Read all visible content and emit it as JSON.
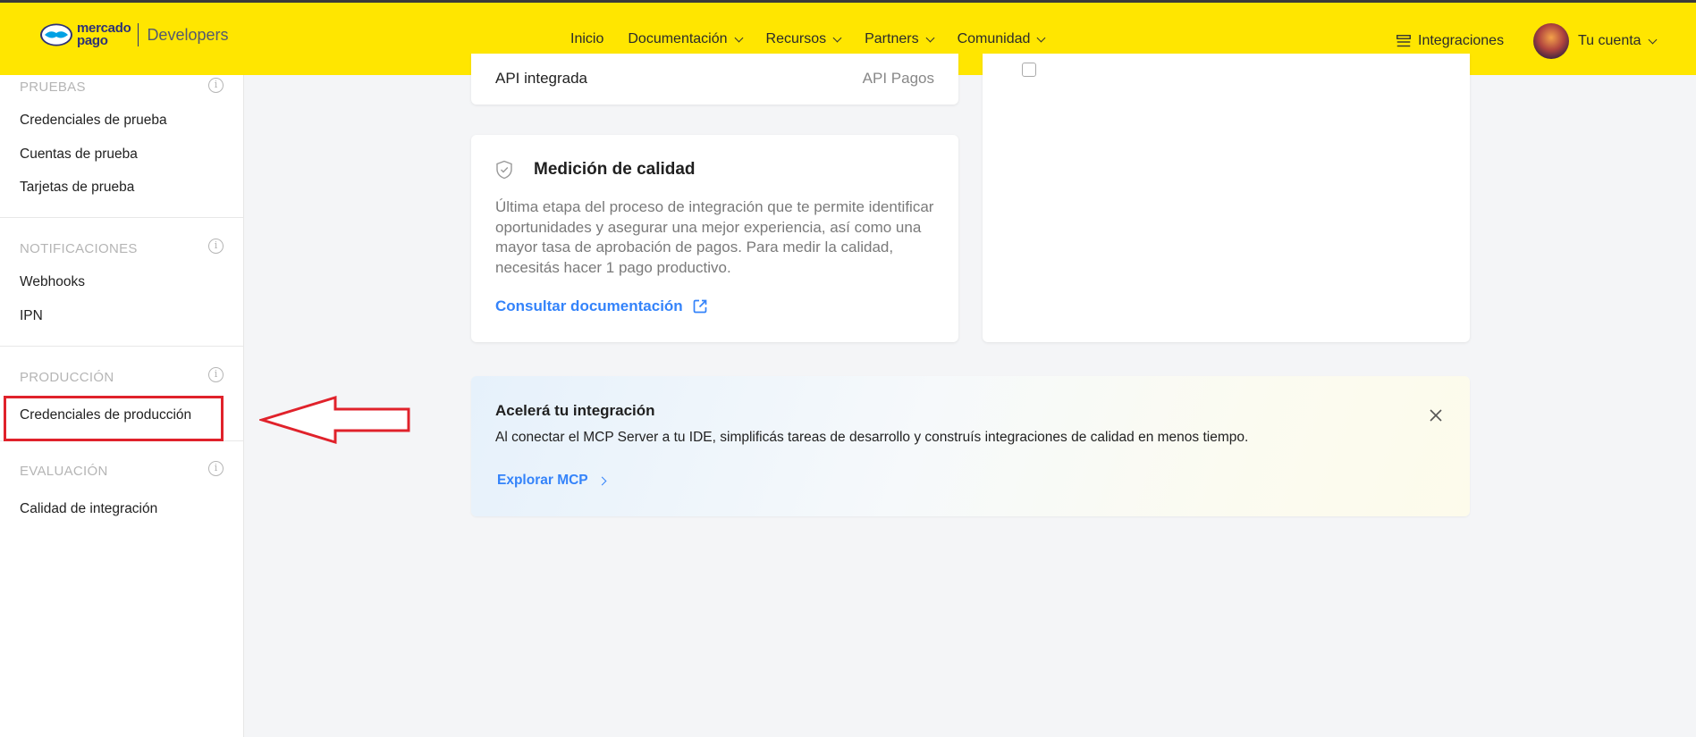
{
  "header": {
    "logo_line1": "mercado",
    "logo_line2": "pago",
    "logo_suffix": "Developers",
    "nav": [
      {
        "label": "Inicio",
        "dropdown": false
      },
      {
        "label": "Documentación",
        "dropdown": true
      },
      {
        "label": "Recursos",
        "dropdown": true
      },
      {
        "label": "Partners",
        "dropdown": true
      },
      {
        "label": "Comunidad",
        "dropdown": true
      }
    ],
    "integrations_label": "Integraciones",
    "account_label": "Tu cuenta",
    "brand_color": "#ffe600"
  },
  "sidebar": {
    "sections": [
      {
        "title": "PRUEBAS",
        "items": [
          "Credenciales de prueba",
          "Cuentas de prueba",
          "Tarjetas de prueba"
        ]
      },
      {
        "title": "NOTIFICACIONES",
        "items": [
          "Webhooks",
          "IPN"
        ]
      },
      {
        "title": "PRODUCCIÓN",
        "items": [
          "Credenciales de producción"
        ]
      },
      {
        "title": "EVALUACIÓN",
        "items": [
          "Calidad de integración"
        ]
      }
    ],
    "highlighted_item": "Credenciales de producción",
    "annotation_color": "#e0222b"
  },
  "main": {
    "api_card": {
      "label": "API integrada",
      "value": "API Pagos"
    },
    "quality_card": {
      "icon": "shield-check-icon",
      "title": "Medición de calidad",
      "description": "Última etapa del proceso de integración que te permite identificar oportunidades y asegurar una mejor experiencia, así como una mayor tasa de aprobación de pagos. Para medir la calidad, necesitás hacer 1 pago productivo.",
      "link_label": "Consultar documentación",
      "link_color": "#3483fa"
    },
    "banner": {
      "title": "Acelerá tu integración",
      "description": "Al conectar el MCP Server a tu IDE, simplificás tareas de desarrollo y construís integraciones de calidad en menos tiempo.",
      "link_label": "Explorar MCP"
    }
  }
}
